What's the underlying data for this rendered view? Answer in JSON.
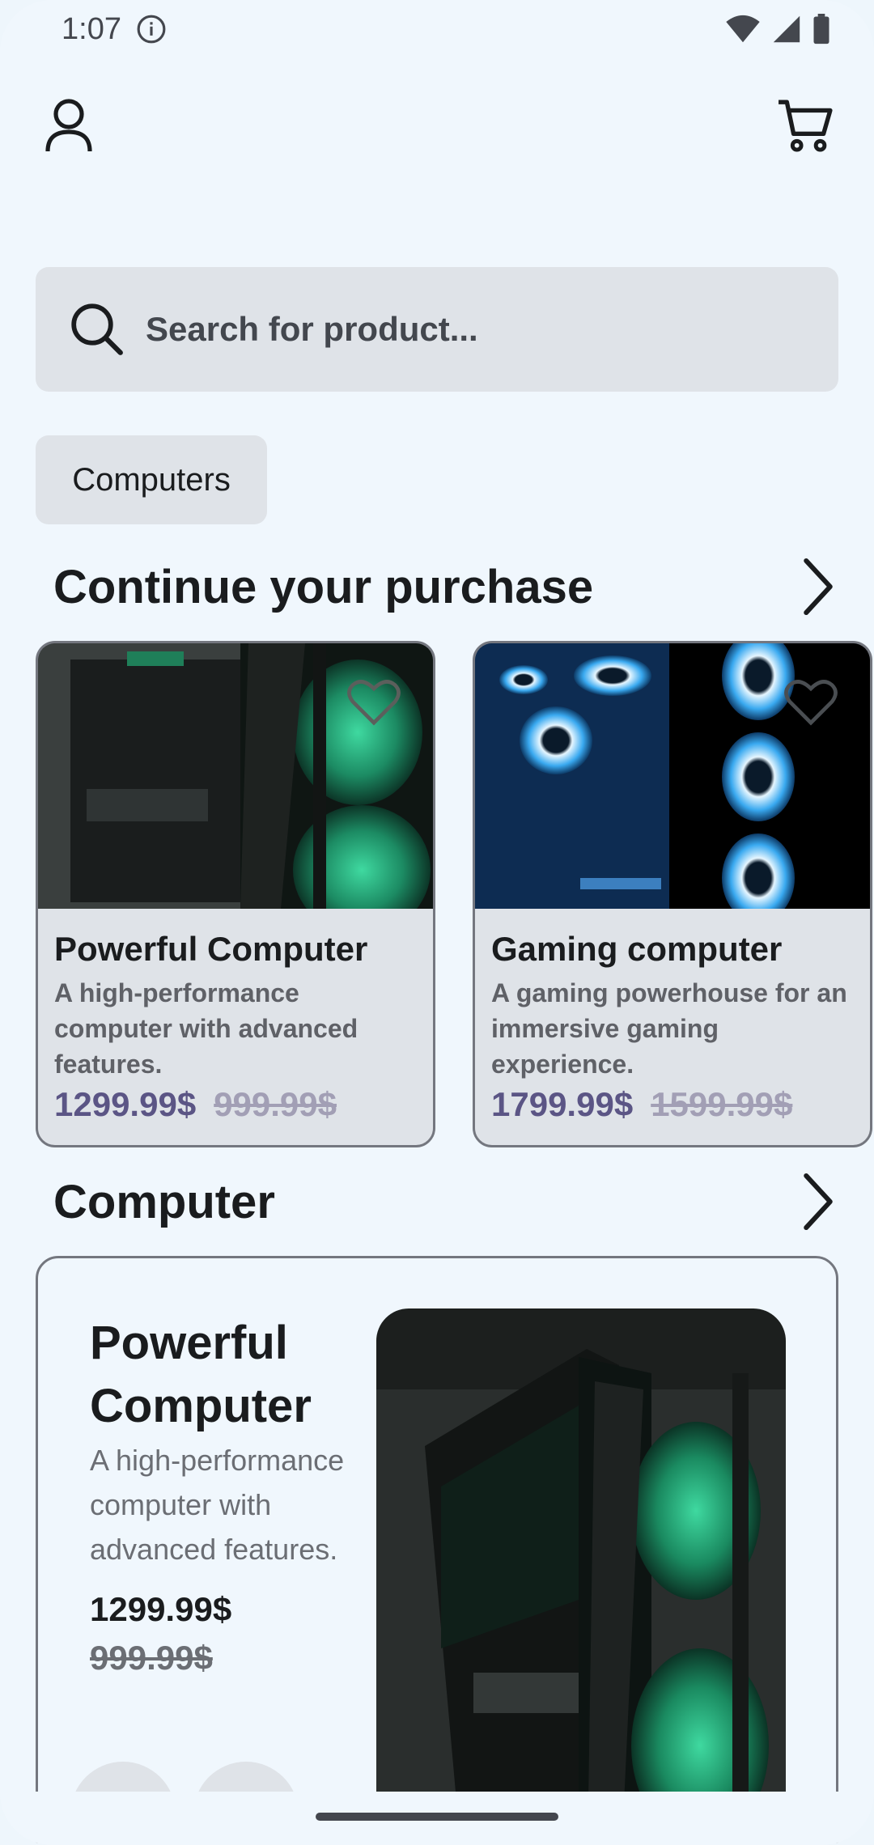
{
  "status_bar": {
    "time": "1:07"
  },
  "search": {
    "placeholder": "Search for product..."
  },
  "categories": [
    {
      "label": "Computers"
    }
  ],
  "continue_section": {
    "title": "Continue your purchase",
    "products": [
      {
        "name": "Powerful Computer",
        "description": "A high-performance computer with advanced features.",
        "price": "1299.99$",
        "old_price": "999.99$"
      },
      {
        "name": "Gaming computer",
        "description": "A gaming powerhouse for an immersive gaming experience.",
        "price": "1799.99$",
        "old_price": "1599.99$"
      }
    ]
  },
  "computer_section": {
    "title": "Computer",
    "featured": {
      "name": "Powerful Computer",
      "description": "A high-performance computer with advanced features.",
      "price": "1299.99$",
      "old_price": "999.99$"
    }
  },
  "colors": {
    "background": "#f0f7fd",
    "surface": "#dfe3e8",
    "price": "#5b5585",
    "outline": "#74777f"
  },
  "icons": [
    "info-icon",
    "wifi-icon",
    "signal-icon",
    "battery-icon",
    "profile-icon",
    "cart-icon",
    "search-icon",
    "chevron-right-icon",
    "heart-icon"
  ]
}
